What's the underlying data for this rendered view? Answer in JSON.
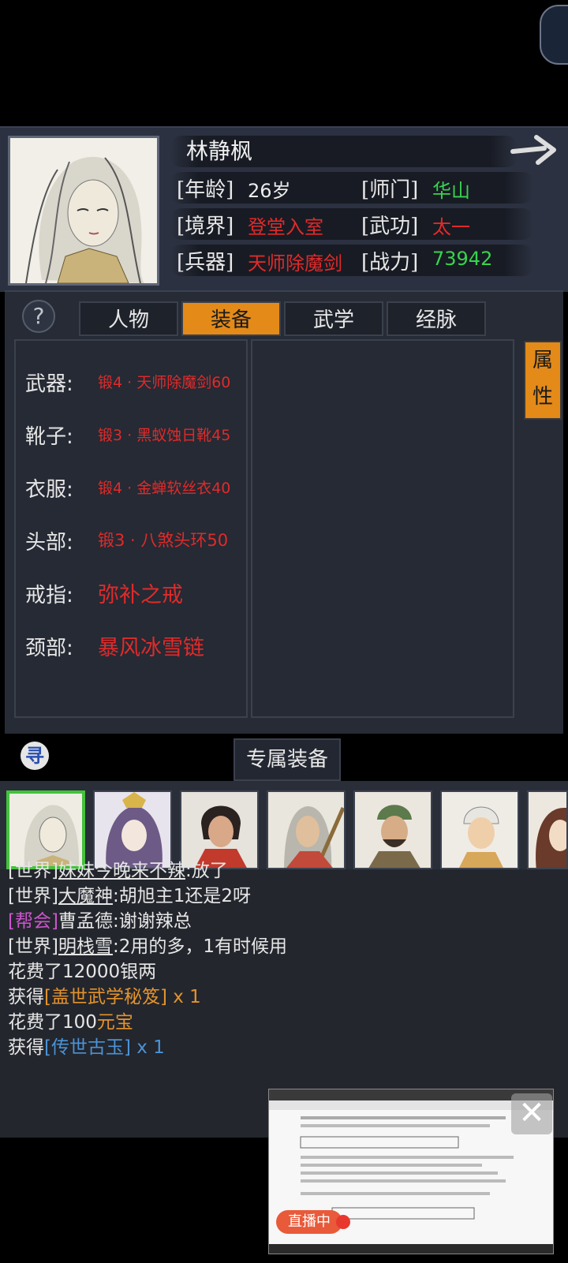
{
  "profile": {
    "name": "林静枫",
    "age_label": "[年龄]",
    "age_value": "26岁",
    "school_label": "[师门]",
    "school_value": "华山",
    "realm_label": "[境界]",
    "realm_value": "登堂入室",
    "skill_label": "[武功]",
    "skill_value": "太一",
    "weapon_label": "[兵器]",
    "weapon_value": "天师除魔剑",
    "power_label": "[战力]",
    "power_value": "73942"
  },
  "tabs": [
    "人物",
    "装备",
    "武学",
    "经脉"
  ],
  "active_tab": "装备",
  "help_symbol": "?",
  "attr_button": [
    "属",
    "性"
  ],
  "equipment": [
    {
      "slot": "武器:",
      "item": "锻4 · 天师除魔剑60"
    },
    {
      "slot": "靴子:",
      "item": "锻3 · 黑蚁蚀日靴45"
    },
    {
      "slot": "衣服:",
      "item": "锻4 · 金蝉软丝衣40"
    },
    {
      "slot": "头部:",
      "item": "锻3 · 八煞头环50"
    },
    {
      "slot": "戒指:",
      "item": "弥补之戒"
    },
    {
      "slot": "颈部:",
      "item": "暴风冰雪链"
    }
  ],
  "seek_symbol": "寻",
  "exclusive_label": "专属装备",
  "chat": {
    "line1": {
      "channel": "[世界]",
      "user": "妹妹今晚来不辣",
      "msg": ":放了"
    },
    "line2": {
      "channel": "[世界]",
      "user": "大魔神",
      "msg": ":胡旭主1还是2呀"
    },
    "line3": {
      "channel": "[帮会]",
      "user": "曹孟德",
      "msg": ":谢谢辣总"
    },
    "line4": {
      "channel": "[世界]",
      "user": "明栈雪",
      "msg": ":2用的多，1有时候用"
    },
    "line5": {
      "text": "花费了12000银两"
    },
    "line6": {
      "prefix": "获得",
      "item": "[盖世武学秘笈]",
      "qty": " x 1"
    },
    "line7": {
      "prefix": "花费了100",
      "item": "元宝"
    },
    "line8": {
      "prefix": "获得",
      "item": "[传世古玉]",
      "qty": " x 1"
    }
  },
  "live": {
    "badge": "直播中",
    "close": "✕"
  },
  "colors": {
    "accent_orange": "#e38a19",
    "green": "#39d34f",
    "red": "#e12a2a",
    "guild_purple": "#cc55cc",
    "item_blue": "#4b93d6"
  }
}
